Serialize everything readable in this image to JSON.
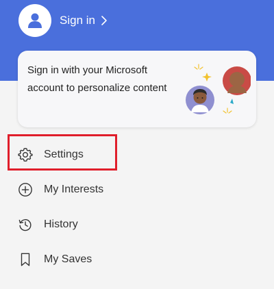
{
  "header": {
    "background_color": "#4a6fdc",
    "avatar_icon": "person-icon",
    "signin_label": "Sign in",
    "chevron_icon": "chevron-right-icon"
  },
  "promo": {
    "text": "Sign in with your Microsoft account to personalize content"
  },
  "menu": {
    "items": [
      {
        "label": "Settings",
        "icon": "gear-icon",
        "highlighted": true
      },
      {
        "label": "My Interests",
        "icon": "plus-circle-icon",
        "highlighted": false
      },
      {
        "label": "History",
        "icon": "history-icon",
        "highlighted": false
      },
      {
        "label": "My Saves",
        "icon": "bookmark-icon",
        "highlighted": false
      }
    ]
  },
  "colors": {
    "highlight": "#e01e2b",
    "text": "#333333"
  }
}
